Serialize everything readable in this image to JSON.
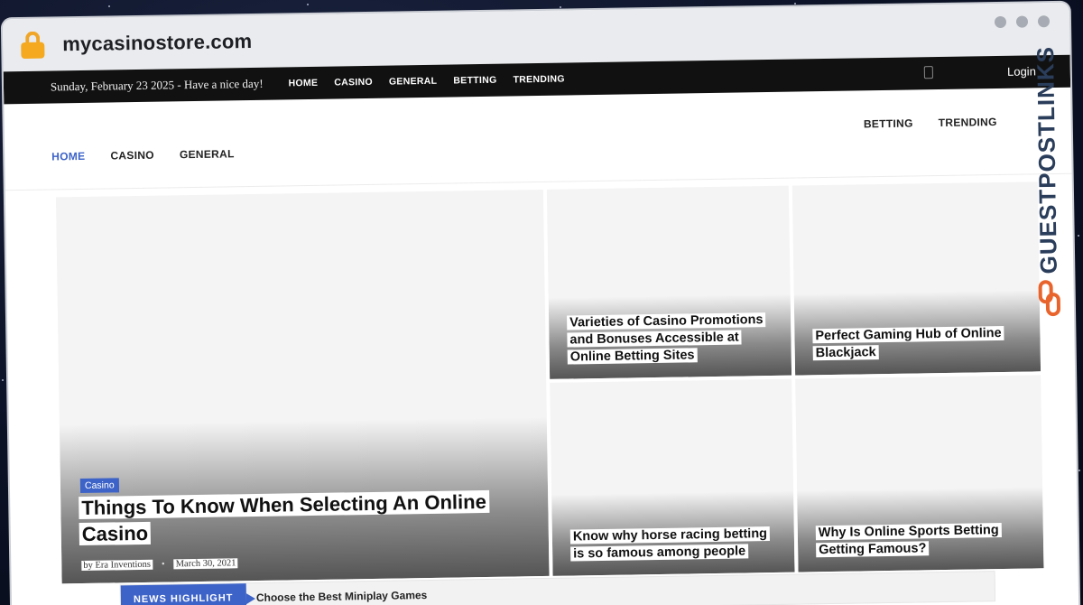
{
  "browser": {
    "url": "mycasinostore.com"
  },
  "topbar": {
    "date": "Sunday, February 23 2025 - Have a nice day!",
    "nav": [
      "HOME",
      "CASINO",
      "GENERAL",
      "BETTING",
      "TRENDING"
    ],
    "login": "Login"
  },
  "mainnav": {
    "left": [
      "HOME",
      "CASINO",
      "GENERAL"
    ],
    "right": [
      "BETTING",
      "TRENDING"
    ]
  },
  "featured": {
    "category": "Casino",
    "title": "Things To Know When Selecting An Online Casino",
    "author": "by Era Inventions",
    "date": "March 30, 2021"
  },
  "cards": [
    {
      "title": "Varieties of Casino Promotions and Bonuses Accessible at Online Betting Sites"
    },
    {
      "title": "Perfect Gaming Hub of Online Blackjack"
    },
    {
      "title": "Know why horse racing betting is so famous among people"
    },
    {
      "title": "Why Is Online Sports Betting Getting Famous?"
    }
  ],
  "news_highlight": {
    "label": "NEWS HIGHLIGHT",
    "text": "Choose the Best Miniplay Games"
  },
  "watermark": {
    "text": "GUESTPOSTLINKS"
  },
  "colors": {
    "accent": "#3d63c8",
    "lock": "#f4a921",
    "watermark": "#2a3d5a",
    "watermark_icon": "#e8642c"
  }
}
